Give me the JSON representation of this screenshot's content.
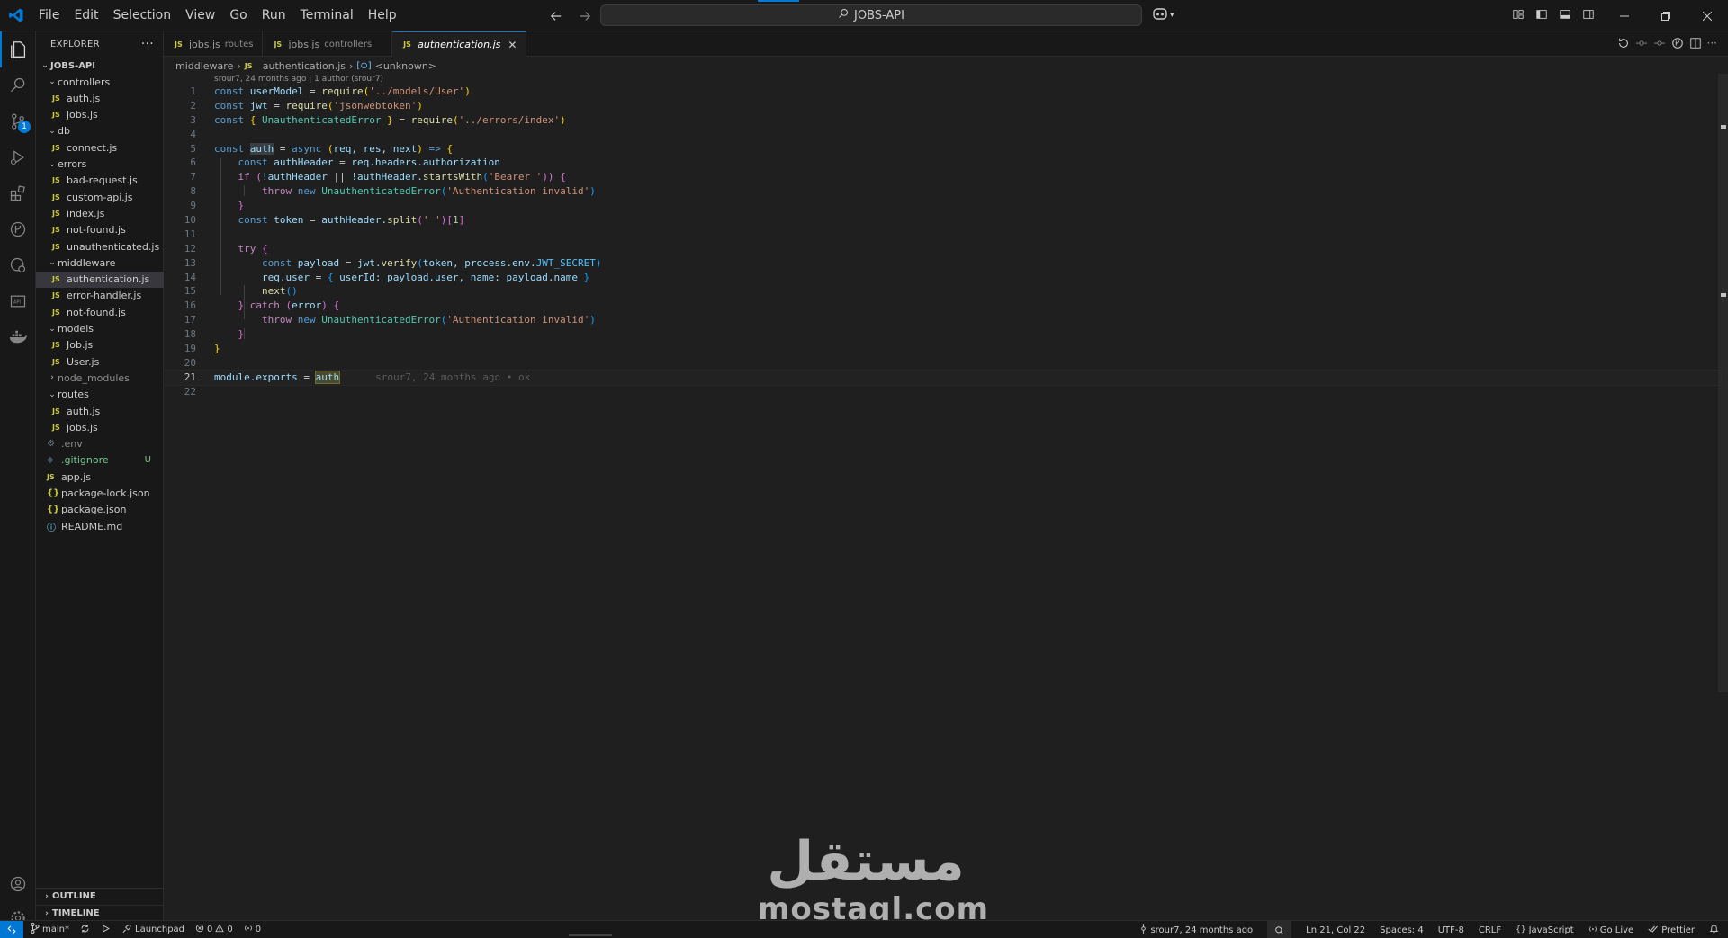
{
  "window": {
    "menu": [
      "File",
      "Edit",
      "Selection",
      "View",
      "Go",
      "Run",
      "Terminal",
      "Help"
    ],
    "search_text": "JOBS-API"
  },
  "sidebar": {
    "title": "EXPLORER",
    "root": "JOBS-API",
    "tree": [
      {
        "label": "controllers",
        "type": "folder"
      },
      {
        "label": "auth.js",
        "type": "js"
      },
      {
        "label": "jobs.js",
        "type": "js"
      },
      {
        "label": "db",
        "type": "folder"
      },
      {
        "label": "connect.js",
        "type": "js"
      },
      {
        "label": "errors",
        "type": "folder"
      },
      {
        "label": "bad-request.js",
        "type": "js"
      },
      {
        "label": "custom-api.js",
        "type": "js"
      },
      {
        "label": "index.js",
        "type": "js"
      },
      {
        "label": "not-found.js",
        "type": "js"
      },
      {
        "label": "unauthenticated.js",
        "type": "js"
      },
      {
        "label": "middleware",
        "type": "folder"
      },
      {
        "label": "authentication.js",
        "type": "js"
      },
      {
        "label": "error-handler.js",
        "type": "js"
      },
      {
        "label": "not-found.js",
        "type": "js"
      },
      {
        "label": "models",
        "type": "folder"
      },
      {
        "label": "Job.js",
        "type": "js"
      },
      {
        "label": "User.js",
        "type": "js"
      },
      {
        "label": "node_modules",
        "type": "folder-closed"
      },
      {
        "label": "routes",
        "type": "folder"
      },
      {
        "label": "auth.js",
        "type": "js"
      },
      {
        "label": "jobs.js",
        "type": "js"
      },
      {
        "label": ".env",
        "type": "env"
      },
      {
        "label": ".gitignore",
        "type": "git",
        "status": "U"
      },
      {
        "label": "app.js",
        "type": "js"
      },
      {
        "label": "package-lock.json",
        "type": "json"
      },
      {
        "label": "package.json",
        "type": "json"
      },
      {
        "label": "README.md",
        "type": "info"
      }
    ],
    "outline": "OUTLINE",
    "timeline": "TIMELINE"
  },
  "tabs": [
    {
      "name": "jobs.js",
      "desc": "routes",
      "active": false
    },
    {
      "name": "jobs.js",
      "desc": "controllers",
      "active": false
    },
    {
      "name": "authentication.js",
      "desc": "",
      "active": true
    }
  ],
  "icon_js": "JS",
  "breadcrumb": {
    "folder": "middleware",
    "file": "authentication.js",
    "symbol": "<unknown>"
  },
  "blame_header": "srour7, 24 months ago | 1 author (srour7)",
  "line_numbers": [
    "1",
    "2",
    "3",
    "4",
    "5",
    "6",
    "7",
    "8",
    "9",
    "10",
    "11",
    "12",
    "13",
    "14",
    "15",
    "16",
    "17",
    "18",
    "19",
    "20",
    "21",
    "22"
  ],
  "code": {
    "l1": [
      "const",
      "userModel",
      "=",
      "require",
      "(",
      "'../models/User'",
      ")"
    ],
    "l2": [
      "const",
      "jwt",
      "=",
      "require",
      "(",
      "'jsonwebtoken'",
      ")"
    ],
    "l3": [
      "const",
      "{",
      "UnauthenticatedError",
      "}",
      "=",
      "require",
      "(",
      "'../errors/index'",
      ")"
    ],
    "l5": [
      "const",
      "auth",
      "=",
      "async",
      "(",
      "req, res, next",
      ")",
      "=>",
      "{"
    ],
    "l6": [
      "const",
      "authHeader",
      "=",
      "req.headers.authorization"
    ],
    "l7": [
      "if",
      "(",
      "!authHeader",
      "||",
      "!authHeader.",
      "startsWith",
      "(",
      "'Bearer '",
      "))",
      "{"
    ],
    "l8": [
      "throw",
      "new",
      "UnauthenticatedError",
      "(",
      "'Authentication invalid'",
      ")"
    ],
    "l9": [
      "}"
    ],
    "l10": [
      "const",
      "token",
      "=",
      "authHeader.",
      "split",
      "(",
      "' '",
      ")",
      "[",
      "1",
      "]"
    ],
    "l12": [
      "try",
      "{"
    ],
    "l13": [
      "const",
      "payload",
      "=",
      "jwt.",
      "verify",
      "(",
      "token, process.env.",
      "JWT_SECRET",
      ")"
    ],
    "l14": [
      "req.user",
      "=",
      "{",
      "userId:",
      "payload.user,",
      "name:",
      "payload.name",
      "}"
    ],
    "l15": [
      "next",
      "()"
    ],
    "l16": [
      "}",
      "catch",
      "(",
      "error",
      ")",
      "{"
    ],
    "l17": [
      "throw",
      "new",
      "UnauthenticatedError",
      "(",
      "'Authentication invalid'",
      ")"
    ],
    "l18": [
      "}"
    ],
    "l19": [
      "}"
    ],
    "l21": [
      "module.exports",
      "=",
      "auth"
    ],
    "l21_blame": "srour7, 24 months ago • ok"
  },
  "watermark": {
    "arabic": "مستقل",
    "latin": "mostaql.com"
  },
  "statusbar": {
    "branch": "main*",
    "launchpad": "Launchpad",
    "errors": "0",
    "warnings": "0",
    "ports": "0",
    "blame": "srour7, 24 months ago",
    "position": "Ln 21, Col 22",
    "spaces": "Spaces: 4",
    "encoding": "UTF-8",
    "eol": "CRLF",
    "language": "JavaScript",
    "golive": "Go Live",
    "prettier": "Prettier"
  },
  "colors": {
    "accent": "#0078d4",
    "background": "#1f1f1f",
    "sidebar": "#181818"
  }
}
